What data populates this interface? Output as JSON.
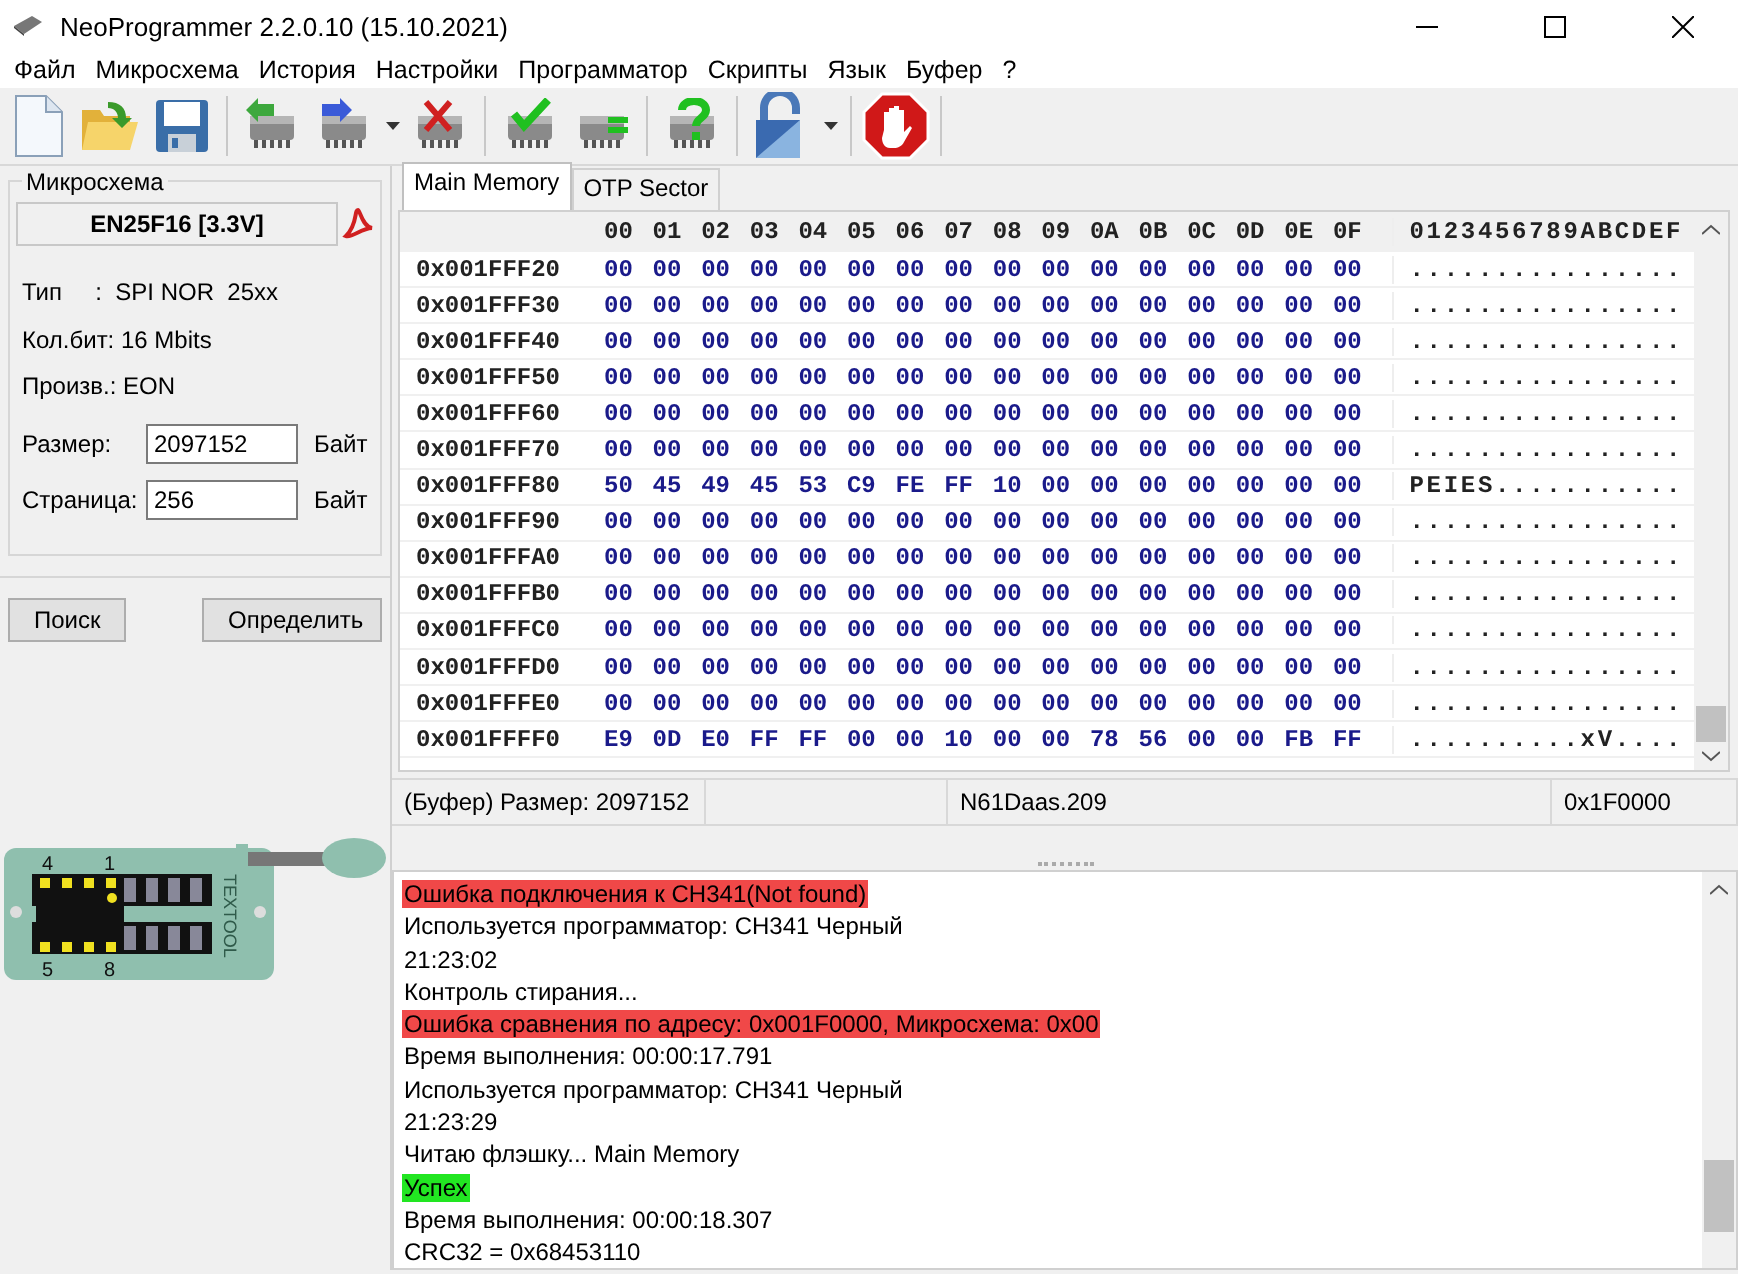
{
  "window": {
    "title": "NeoProgrammer 2.2.0.10 (15.10.2021)"
  },
  "menu": [
    "Файл",
    "Микросхема",
    "История",
    "Настройки",
    "Программатор",
    "Скрипты",
    "Язык",
    "Буфер",
    "?"
  ],
  "toolbar": [
    {
      "kind": "new"
    },
    {
      "kind": "open"
    },
    {
      "kind": "save"
    },
    {
      "kind": "sep"
    },
    {
      "kind": "read"
    },
    {
      "kind": "write"
    },
    {
      "kind": "dropdown"
    },
    {
      "kind": "erase"
    },
    {
      "kind": "sep"
    },
    {
      "kind": "verify"
    },
    {
      "kind": "compare"
    },
    {
      "kind": "sep"
    },
    {
      "kind": "detect"
    },
    {
      "kind": "sep"
    },
    {
      "kind": "lock"
    },
    {
      "kind": "dropdown"
    },
    {
      "kind": "sep"
    },
    {
      "kind": "stop"
    },
    {
      "kind": "sep"
    }
  ],
  "chip_panel": {
    "title": "Микросхема",
    "chip": "EN25F16 [3.3V]",
    "info": [
      "Тип     :  SPI NOR  25xx",
      "Кол.бит: 16 Mbits",
      "Произв.: EON"
    ],
    "fields": [
      {
        "label": "Размер:",
        "value": "2097152",
        "unit": "Байт"
      },
      {
        "label": "Страница:",
        "value": "256",
        "unit": "Байт"
      }
    ],
    "buttons": [
      "Поиск",
      "Определить"
    ]
  },
  "socket": {
    "pin_labels": [
      "4",
      "1",
      "5",
      "8"
    ],
    "brand": "TEXTOOL"
  },
  "tabs": [
    {
      "label": "Main Memory",
      "selected": true
    },
    {
      "label": "OTP Sector",
      "selected": false
    }
  ],
  "hex": {
    "columns": [
      "00",
      "01",
      "02",
      "03",
      "04",
      "05",
      "06",
      "07",
      "08",
      "09",
      "0A",
      "0B",
      "0C",
      "0D",
      "0E",
      "0F"
    ],
    "ascii_header": "0123456789ABCDEF",
    "rows": [
      {
        "address": "0x001FFF20",
        "bytes": [
          "00",
          "00",
          "00",
          "00",
          "00",
          "00",
          "00",
          "00",
          "00",
          "00",
          "00",
          "00",
          "00",
          "00",
          "00",
          "00"
        ],
        "ascii": "................"
      },
      {
        "address": "0x001FFF30",
        "bytes": [
          "00",
          "00",
          "00",
          "00",
          "00",
          "00",
          "00",
          "00",
          "00",
          "00",
          "00",
          "00",
          "00",
          "00",
          "00",
          "00"
        ],
        "ascii": "................"
      },
      {
        "address": "0x001FFF40",
        "bytes": [
          "00",
          "00",
          "00",
          "00",
          "00",
          "00",
          "00",
          "00",
          "00",
          "00",
          "00",
          "00",
          "00",
          "00",
          "00",
          "00"
        ],
        "ascii": "................"
      },
      {
        "address": "0x001FFF50",
        "bytes": [
          "00",
          "00",
          "00",
          "00",
          "00",
          "00",
          "00",
          "00",
          "00",
          "00",
          "00",
          "00",
          "00",
          "00",
          "00",
          "00"
        ],
        "ascii": "................"
      },
      {
        "address": "0x001FFF60",
        "bytes": [
          "00",
          "00",
          "00",
          "00",
          "00",
          "00",
          "00",
          "00",
          "00",
          "00",
          "00",
          "00",
          "00",
          "00",
          "00",
          "00"
        ],
        "ascii": "................"
      },
      {
        "address": "0x001FFF70",
        "bytes": [
          "00",
          "00",
          "00",
          "00",
          "00",
          "00",
          "00",
          "00",
          "00",
          "00",
          "00",
          "00",
          "00",
          "00",
          "00",
          "00"
        ],
        "ascii": "................"
      },
      {
        "address": "0x001FFF80",
        "bytes": [
          "50",
          "45",
          "49",
          "45",
          "53",
          "C9",
          "FE",
          "FF",
          "10",
          "00",
          "00",
          "00",
          "00",
          "00",
          "00",
          "00"
        ],
        "ascii": "PEIES..........."
      },
      {
        "address": "0x001FFF90",
        "bytes": [
          "00",
          "00",
          "00",
          "00",
          "00",
          "00",
          "00",
          "00",
          "00",
          "00",
          "00",
          "00",
          "00",
          "00",
          "00",
          "00"
        ],
        "ascii": "................"
      },
      {
        "address": "0x001FFFA0",
        "bytes": [
          "00",
          "00",
          "00",
          "00",
          "00",
          "00",
          "00",
          "00",
          "00",
          "00",
          "00",
          "00",
          "00",
          "00",
          "00",
          "00"
        ],
        "ascii": "................"
      },
      {
        "address": "0x001FFFB0",
        "bytes": [
          "00",
          "00",
          "00",
          "00",
          "00",
          "00",
          "00",
          "00",
          "00",
          "00",
          "00",
          "00",
          "00",
          "00",
          "00",
          "00"
        ],
        "ascii": "................"
      },
      {
        "address": "0x001FFFC0",
        "bytes": [
          "00",
          "00",
          "00",
          "00",
          "00",
          "00",
          "00",
          "00",
          "00",
          "00",
          "00",
          "00",
          "00",
          "00",
          "00",
          "00"
        ],
        "ascii": "................"
      },
      {
        "address": "0x001FFFD0",
        "bytes": [
          "00",
          "00",
          "00",
          "00",
          "00",
          "00",
          "00",
          "00",
          "00",
          "00",
          "00",
          "00",
          "00",
          "00",
          "00",
          "00"
        ],
        "ascii": "................"
      },
      {
        "address": "0x001FFFE0",
        "bytes": [
          "00",
          "00",
          "00",
          "00",
          "00",
          "00",
          "00",
          "00",
          "00",
          "00",
          "00",
          "00",
          "00",
          "00",
          "00",
          "00"
        ],
        "ascii": "................"
      },
      {
        "address": "0x001FFFF0",
        "bytes": [
          "E9",
          "0D",
          "E0",
          "FF",
          "FF",
          "00",
          "00",
          "10",
          "00",
          "00",
          "78",
          "56",
          "00",
          "00",
          "FB",
          "FF"
        ],
        "ascii": "..........xV...."
      }
    ]
  },
  "status_bar": [
    "(Буфер) Размер: 2097152",
    "N61Daas.209",
    "0x1F0000"
  ],
  "log": [
    {
      "kind": "error",
      "text": "Ошибка подключения к CH341(Not found)"
    },
    {
      "kind": "normal",
      "text": "Используется программатор: CH341 Черный"
    },
    {
      "kind": "normal",
      "text": "21:23:02"
    },
    {
      "kind": "normal",
      "text": "Контроль стирания..."
    },
    {
      "kind": "error",
      "text": "Ошибка сравнения по адресу: 0x001F0000, Микросхема: 0x00"
    },
    {
      "kind": "normal",
      "text": "Время выполнения: 00:00:17.791"
    },
    {
      "kind": "normal",
      "text": "Используется программатор: CH341 Черный"
    },
    {
      "kind": "normal",
      "text": "21:23:29"
    },
    {
      "kind": "normal",
      "text": "Читаю флэшку... Main Memory"
    },
    {
      "kind": "success",
      "text": "Успех"
    },
    {
      "kind": "normal",
      "text": "Время выполнения: 00:00:18.307"
    },
    {
      "kind": "normal",
      "text": "CRC32 = 0x68453110"
    }
  ]
}
